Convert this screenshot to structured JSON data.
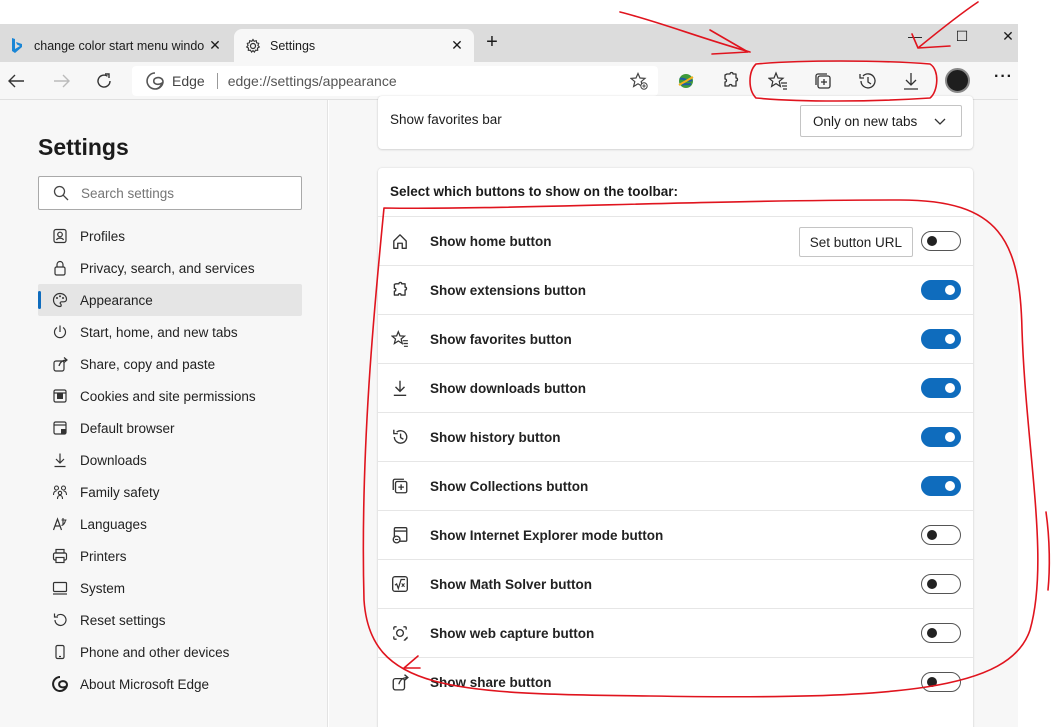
{
  "tabs": [
    {
      "title": "change color start menu window",
      "icon": "bing-icon",
      "active": false
    },
    {
      "title": "Settings",
      "icon": "gear-icon",
      "active": true
    }
  ],
  "address": {
    "site_label": "Edge",
    "url": "edge://settings/appearance"
  },
  "sidebar": {
    "title": "Settings",
    "search_placeholder": "Search settings",
    "items": [
      {
        "label": "Profiles",
        "icon": "profile-icon"
      },
      {
        "label": "Privacy, search, and services",
        "icon": "lock-icon"
      },
      {
        "label": "Appearance",
        "icon": "palette-icon",
        "active": true
      },
      {
        "label": "Start, home, and new tabs",
        "icon": "power-icon"
      },
      {
        "label": "Share, copy and paste",
        "icon": "share-icon"
      },
      {
        "label": "Cookies and site permissions",
        "icon": "cookies-icon"
      },
      {
        "label": "Default browser",
        "icon": "browser-icon"
      },
      {
        "label": "Downloads",
        "icon": "download-icon"
      },
      {
        "label": "Family safety",
        "icon": "family-icon"
      },
      {
        "label": "Languages",
        "icon": "languages-icon"
      },
      {
        "label": "Printers",
        "icon": "printer-icon"
      },
      {
        "label": "System",
        "icon": "system-icon"
      },
      {
        "label": "Reset settings",
        "icon": "reset-icon"
      },
      {
        "label": "Phone and other devices",
        "icon": "phone-icon"
      },
      {
        "label": "About Microsoft Edge",
        "icon": "edge-icon"
      }
    ]
  },
  "favorites_bar": {
    "label": "Show favorites bar",
    "value": "Only on new tabs"
  },
  "toolbar_section": {
    "title": "Select which buttons to show on the toolbar:",
    "set_button_url": "Set button URL",
    "rows": [
      {
        "label": "Show home button",
        "icon": "home-icon",
        "on": false
      },
      {
        "label": "Show extensions button",
        "icon": "extensions-icon",
        "on": true
      },
      {
        "label": "Show favorites button",
        "icon": "favorites-icon",
        "on": true
      },
      {
        "label": "Show downloads button",
        "icon": "download-icon",
        "on": true
      },
      {
        "label": "Show history button",
        "icon": "history-icon",
        "on": true
      },
      {
        "label": "Show Collections button",
        "icon": "collections-icon",
        "on": true
      },
      {
        "label": "Show Internet Explorer mode button",
        "icon": "ie-mode-icon",
        "on": false
      },
      {
        "label": "Show Math Solver button",
        "icon": "math-solver-icon",
        "on": false
      },
      {
        "label": "Show web capture button",
        "icon": "web-capture-icon",
        "on": false
      },
      {
        "label": "Show share button",
        "icon": "share-icon",
        "on": false
      }
    ]
  },
  "colors": {
    "accent": "#0f6cbd",
    "annotation": "#e0141e"
  }
}
